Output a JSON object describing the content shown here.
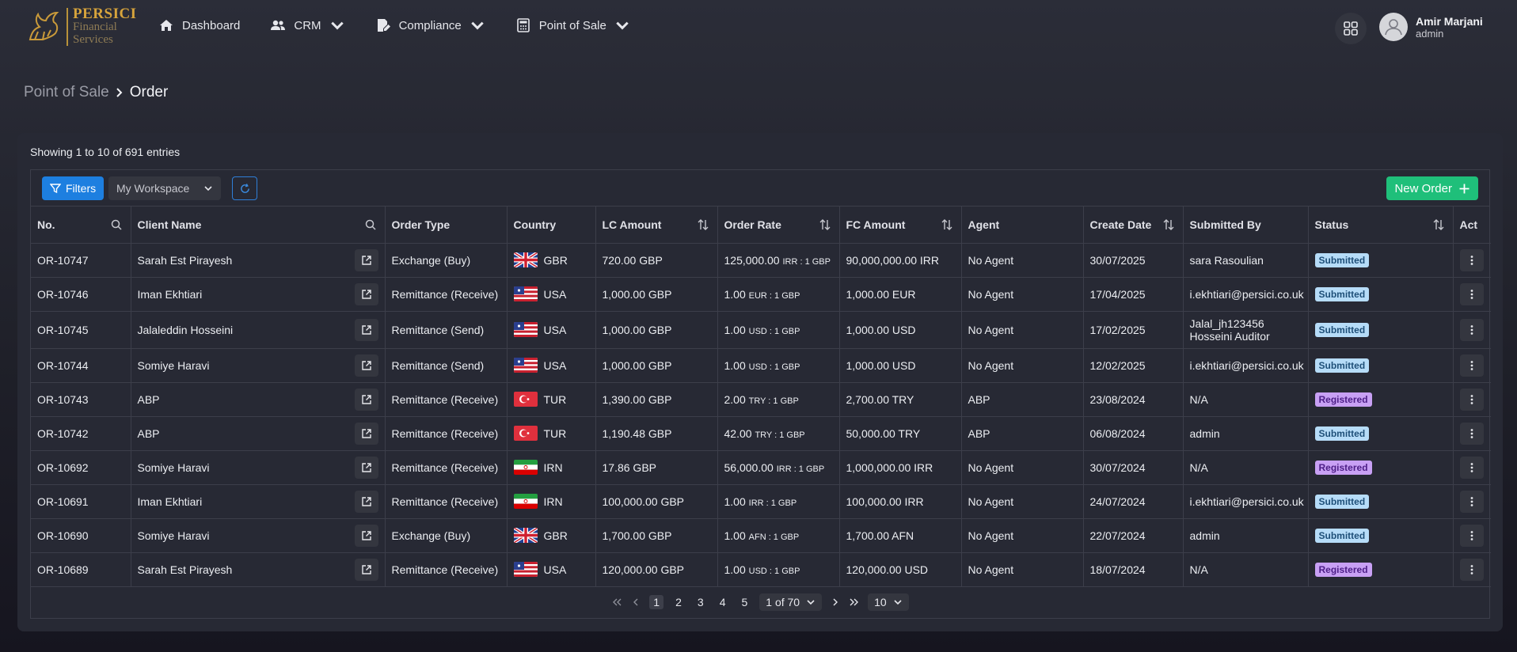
{
  "brand": {
    "title": "PERSICI",
    "line1": "Financial",
    "line2": "Services",
    "color": "#d7a43c"
  },
  "nav": [
    {
      "label": "Dashboard",
      "icon": "home-icon",
      "has_dropdown": false
    },
    {
      "label": "CRM",
      "icon": "users-icon",
      "has_dropdown": true
    },
    {
      "label": "Compliance",
      "icon": "document-edit-icon",
      "has_dropdown": true
    },
    {
      "label": "Point of Sale",
      "icon": "calculator-icon",
      "has_dropdown": true
    }
  ],
  "user": {
    "name": "Amir Marjani",
    "role": "admin"
  },
  "breadcrumb": {
    "parent": "Point of Sale",
    "current": "Order"
  },
  "summary": "Showing 1 to 10 of 691 entries",
  "toolbar": {
    "filters_label": "Filters",
    "workspace_value": "My Workspace",
    "new_order_label": "New Order"
  },
  "columns": [
    "No.",
    "Client Name",
    "Order Type",
    "Country",
    "LC Amount",
    "Order Rate",
    "FC Amount",
    "Agent",
    "Create Date",
    "Submitted By",
    "Status",
    "Act"
  ],
  "colors": {
    "submitted_bg": "#b6dcf8",
    "registered_bg": "#c8a0f4",
    "primary": "#1d7fe0",
    "success": "#1fbf7a"
  },
  "rows": [
    {
      "no": "OR-10747",
      "client": "Sarah Est Pirayesh",
      "type": "Exchange (Buy)",
      "flag": "gbr",
      "country": "GBR",
      "lc": "720.00 GBP",
      "rate_val": "125,000.00",
      "rate_rest": "IRR : 1 GBP",
      "fc": "90,000,000.00 IRR",
      "agent": "No Agent",
      "date": "30/07/2025",
      "by1": "sara Rasoulian",
      "by2": "",
      "status": "Submitted",
      "status_key": "submitted"
    },
    {
      "no": "OR-10746",
      "client": "Iman Ekhtiari",
      "type": "Remittance (Receive)",
      "flag": "usa",
      "country": "USA",
      "lc": "1,000.00 GBP",
      "rate_val": "1.00",
      "rate_rest": "EUR : 1 GBP",
      "fc": "1,000.00 EUR",
      "agent": "No Agent",
      "date": "17/04/2025",
      "by1": "i.ekhtiari@persici.co.uk",
      "by2": "",
      "status": "Submitted",
      "status_key": "submitted"
    },
    {
      "no": "OR-10745",
      "client": "Jalaleddin Hosseini",
      "type": "Remittance (Send)",
      "flag": "usa",
      "country": "USA",
      "lc": "1,000.00 GBP",
      "rate_val": "1.00",
      "rate_rest": "USD : 1 GBP",
      "fc": "1,000.00 USD",
      "agent": "No Agent",
      "date": "17/02/2025",
      "by1": "Jalal_jh123456",
      "by2": "Hosseini Auditor",
      "status": "Submitted",
      "status_key": "submitted"
    },
    {
      "no": "OR-10744",
      "client": "Somiye Haravi",
      "type": "Remittance (Send)",
      "flag": "usa",
      "country": "USA",
      "lc": "1,000.00 GBP",
      "rate_val": "1.00",
      "rate_rest": "USD : 1 GBP",
      "fc": "1,000.00 USD",
      "agent": "No Agent",
      "date": "12/02/2025",
      "by1": "i.ekhtiari@persici.co.uk",
      "by2": "",
      "status": "Submitted",
      "status_key": "submitted"
    },
    {
      "no": "OR-10743",
      "client": "ABP",
      "type": "Remittance (Receive)",
      "flag": "tur",
      "country": "TUR",
      "lc": "1,390.00 GBP",
      "rate_val": "2.00",
      "rate_rest": "TRY : 1 GBP",
      "fc": "2,700.00 TRY",
      "agent": "ABP",
      "date": "23/08/2024",
      "by1": "N/A",
      "by2": "",
      "status": "Registered",
      "status_key": "registered"
    },
    {
      "no": "OR-10742",
      "client": "ABP",
      "type": "Remittance (Receive)",
      "flag": "tur",
      "country": "TUR",
      "lc": "1,190.48 GBP",
      "rate_val": "42.00",
      "rate_rest": "TRY : 1 GBP",
      "fc": "50,000.00 TRY",
      "agent": "ABP",
      "date": "06/08/2024",
      "by1": "admin",
      "by2": "",
      "status": "Submitted",
      "status_key": "submitted"
    },
    {
      "no": "OR-10692",
      "client": "Somiye Haravi",
      "type": "Remittance (Receive)",
      "flag": "irn",
      "country": "IRN",
      "lc": "17.86 GBP",
      "rate_val": "56,000.00",
      "rate_rest": "IRR : 1 GBP",
      "fc": "1,000,000.00 IRR",
      "agent": "No Agent",
      "date": "30/07/2024",
      "by1": "N/A",
      "by2": "",
      "status": "Registered",
      "status_key": "registered"
    },
    {
      "no": "OR-10691",
      "client": "Iman Ekhtiari",
      "type": "Remittance (Receive)",
      "flag": "irn",
      "country": "IRN",
      "lc": "100,000.00 GBP",
      "rate_val": "1.00",
      "rate_rest": "IRR : 1 GBP",
      "fc": "100,000.00 IRR",
      "agent": "No Agent",
      "date": "24/07/2024",
      "by1": "i.ekhtiari@persici.co.uk",
      "by2": "",
      "status": "Submitted",
      "status_key": "submitted"
    },
    {
      "no": "OR-10690",
      "client": "Somiye Haravi",
      "type": "Exchange (Buy)",
      "flag": "gbr",
      "country": "GBR",
      "lc": "1,700.00 GBP",
      "rate_val": "1.00",
      "rate_rest": "AFN : 1 GBP",
      "fc": "1,700.00 AFN",
      "agent": "No Agent",
      "date": "22/07/2024",
      "by1": "admin",
      "by2": "",
      "status": "Submitted",
      "status_key": "submitted"
    },
    {
      "no": "OR-10689",
      "client": "Sarah Est Pirayesh",
      "type": "Remittance (Receive)",
      "flag": "usa",
      "country": "USA",
      "lc": "120,000.00 GBP",
      "rate_val": "1.00",
      "rate_rest": "USD : 1 GBP",
      "fc": "120,000.00 USD",
      "agent": "No Agent",
      "date": "18/07/2024",
      "by1": "N/A",
      "by2": "",
      "status": "Registered",
      "status_key": "registered"
    }
  ],
  "pagination": {
    "pages": [
      "1",
      "2",
      "3",
      "4",
      "5"
    ],
    "current": "1",
    "page_of": "1 of 70",
    "page_size": "10"
  }
}
